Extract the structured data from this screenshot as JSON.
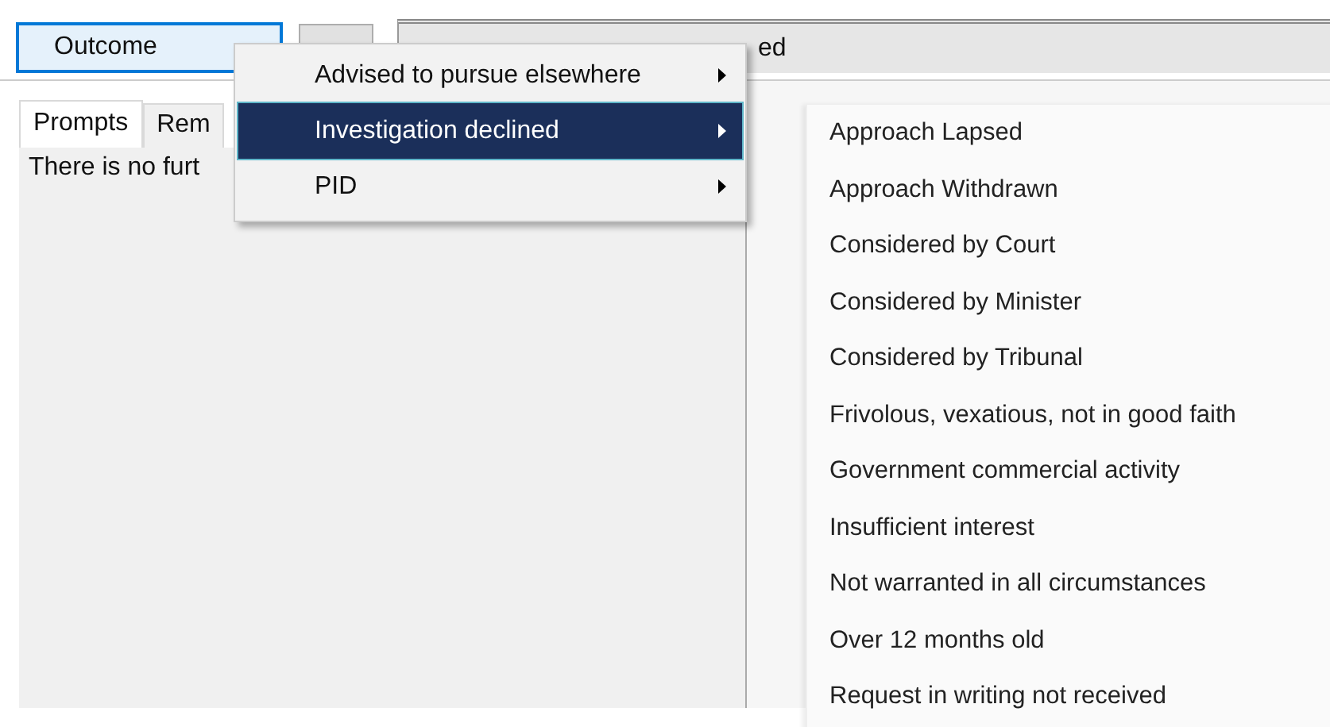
{
  "toolbar": {
    "outcome_button": "Outcome",
    "field_value": "ed"
  },
  "tabs": [
    {
      "label": "Prompts",
      "selected": true
    },
    {
      "label": "Rem",
      "selected": false
    }
  ],
  "panel_text": "There is no furt",
  "menu": {
    "items": [
      {
        "label": "Advised to pursue elsewhere",
        "selected": false
      },
      {
        "label": "Investigation declined",
        "selected": true
      },
      {
        "label": "PID",
        "selected": false
      }
    ]
  },
  "submenu": {
    "items": [
      "Approach Lapsed",
      "Approach Withdrawn",
      "Considered by Court",
      "Considered by Minister",
      "Considered by Tribunal",
      "Frivolous, vexatious, not in good faith",
      "Government commercial activity",
      "Insufficient interest",
      "Not warranted in all circumstances",
      "Over 12 months old",
      "Request in writing not received"
    ]
  }
}
